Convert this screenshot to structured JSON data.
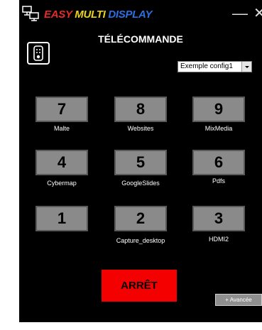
{
  "app": {
    "title_parts": [
      "EASY",
      "MULTI",
      "DISPLAY"
    ],
    "minimize_glyph": "—",
    "close_glyph": "✕"
  },
  "page": {
    "title": "TÉLÉCOMMANDE"
  },
  "config": {
    "selected": "Exemple config1"
  },
  "buttons": [
    {
      "number": "7",
      "label": "Malte"
    },
    {
      "number": "8",
      "label": "Websites"
    },
    {
      "number": "9",
      "label": "MixMedia"
    },
    {
      "number": "4",
      "label": "Cybermap"
    },
    {
      "number": "5",
      "label": "GoogleSlides"
    },
    {
      "number": "6",
      "label": "Pdfs"
    },
    {
      "number": "1",
      "label": ""
    },
    {
      "number": "2",
      "label": "Capture_desktop"
    },
    {
      "number": "3",
      "label": "HDMI2"
    }
  ],
  "stop": {
    "label": "ARRÊT"
  },
  "advanced": {
    "label": "+ Avancée"
  },
  "icons": {
    "app": "monitors-icon",
    "remote": "remote-control-icon"
  },
  "colors": {
    "background": "#000000",
    "button": "#8a8a8a",
    "stop": "#f50000",
    "easy": "#e62a2a",
    "multi": "#e8d21a",
    "display": "#2d6fe0"
  }
}
